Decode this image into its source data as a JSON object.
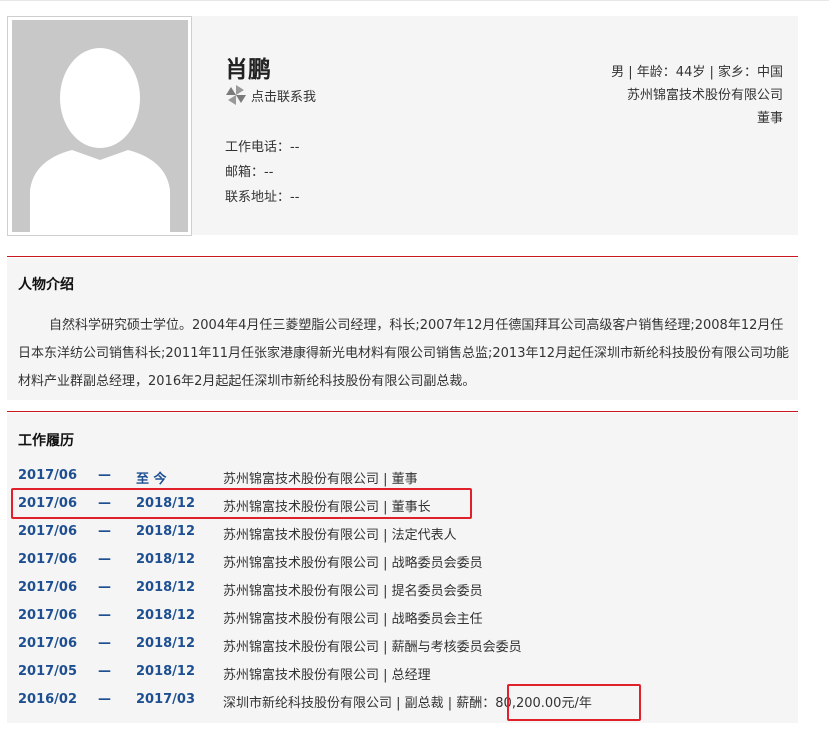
{
  "profile": {
    "name": "肖鹏",
    "contact_label": "点击联系我",
    "phone_label": "工作电话：--",
    "email_label": "邮箱：--",
    "address_label": "联系地址：--",
    "meta_line1": "男 | 年龄：44岁 | 家乡：中国",
    "company": "苏州锦富技术股份有限公司",
    "position": "董事"
  },
  "intro": {
    "title": "人物介绍",
    "text": "自然科学研究硕士学位。2004年4月任三菱塑脂公司经理，科长;2007年12月任德国拜耳公司高级客户销售经理;2008年12月任日本东洋纺公司销售科长;2011年11月任张家港康得新光电材料有限公司销售总监;2013年12月起任深圳市新纶科技股份有限公司功能材料产业群副总经理，2016年2月起起任深圳市新纶科技股份有限公司副总裁。"
  },
  "career": {
    "title": "工作履历",
    "dash": "—",
    "rows": [
      {
        "start": "2017/06",
        "end": "至 今",
        "desc": "苏州锦富技术股份有限公司 | 董事"
      },
      {
        "start": "2017/06",
        "end": "2018/12",
        "desc": "苏州锦富技术股份有限公司 | 董事长"
      },
      {
        "start": "2017/06",
        "end": "2018/12",
        "desc": "苏州锦富技术股份有限公司 | 法定代表人"
      },
      {
        "start": "2017/06",
        "end": "2018/12",
        "desc": "苏州锦富技术股份有限公司 | 战略委员会委员"
      },
      {
        "start": "2017/06",
        "end": "2018/12",
        "desc": "苏州锦富技术股份有限公司 | 提名委员会委员"
      },
      {
        "start": "2017/06",
        "end": "2018/12",
        "desc": "苏州锦富技术股份有限公司 | 战略委员会主任"
      },
      {
        "start": "2017/06",
        "end": "2018/12",
        "desc": "苏州锦富技术股份有限公司 | 薪酬与考核委员会委员"
      },
      {
        "start": "2017/05",
        "end": "2018/12",
        "desc": "苏州锦富技术股份有限公司 | 总经理"
      },
      {
        "start": "2016/02",
        "end": "2017/03",
        "desc": "深圳市新纶科技股份有限公司 | 副总裁 | 薪酬：80,200.00元/年"
      }
    ]
  },
  "colors": {
    "accent_red": "#c9171f",
    "date_blue": "#1d4f91",
    "highlight": "#e0202a"
  }
}
